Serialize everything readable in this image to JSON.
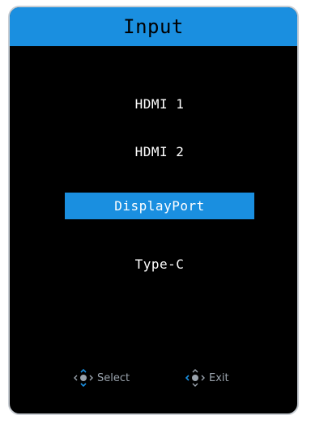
{
  "header": {
    "title": "Input"
  },
  "menu": {
    "items": [
      {
        "label": "HDMI 1",
        "selected": false
      },
      {
        "label": "HDMI 2",
        "selected": false
      },
      {
        "label": "DisplayPort",
        "selected": true
      },
      {
        "label": "Type-C",
        "selected": false
      }
    ]
  },
  "footer": {
    "select_label": "Select",
    "exit_label": "Exit",
    "select_icon": "joystick-select-icon",
    "exit_icon": "joystick-exit-icon"
  },
  "colors": {
    "accent": "#1a8fe0",
    "background": "#000000",
    "text": "#ffffff",
    "hint_text": "#9aa3ad"
  }
}
